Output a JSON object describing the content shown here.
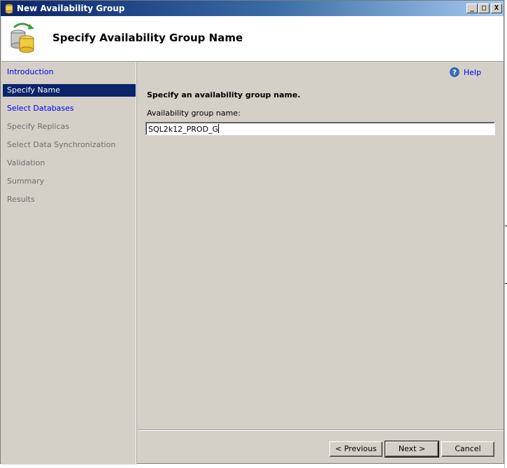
{
  "window": {
    "title": "New Availability Group"
  },
  "title_buttons": {
    "minimize": "_",
    "maximize": "□",
    "close": "X"
  },
  "header": {
    "title": "Specify Availability Group Name"
  },
  "nav": {
    "items": [
      {
        "label": "Introduction",
        "state": "link"
      },
      {
        "label": "Specify Name",
        "state": "selected"
      },
      {
        "label": "Select Databases",
        "state": "link"
      },
      {
        "label": "Specify Replicas",
        "state": "disabled"
      },
      {
        "label": "Select Data Synchronization",
        "state": "disabled"
      },
      {
        "label": "Validation",
        "state": "disabled"
      },
      {
        "label": "Summary",
        "state": "disabled"
      },
      {
        "label": "Results",
        "state": "disabled"
      }
    ]
  },
  "help": {
    "label": "Help"
  },
  "content": {
    "heading": "Specify an availability group name.",
    "field_label": "Availability group name:",
    "field_value": "SQL2k12_PROD_G"
  },
  "buttons": {
    "previous": "< Previous",
    "next": "Next >",
    "cancel": "Cancel"
  },
  "colors": {
    "titlebar": "#0a246a",
    "selected_nav": "#0a246a",
    "link": "#0000ee",
    "window_bg": "#d4d0c8"
  }
}
